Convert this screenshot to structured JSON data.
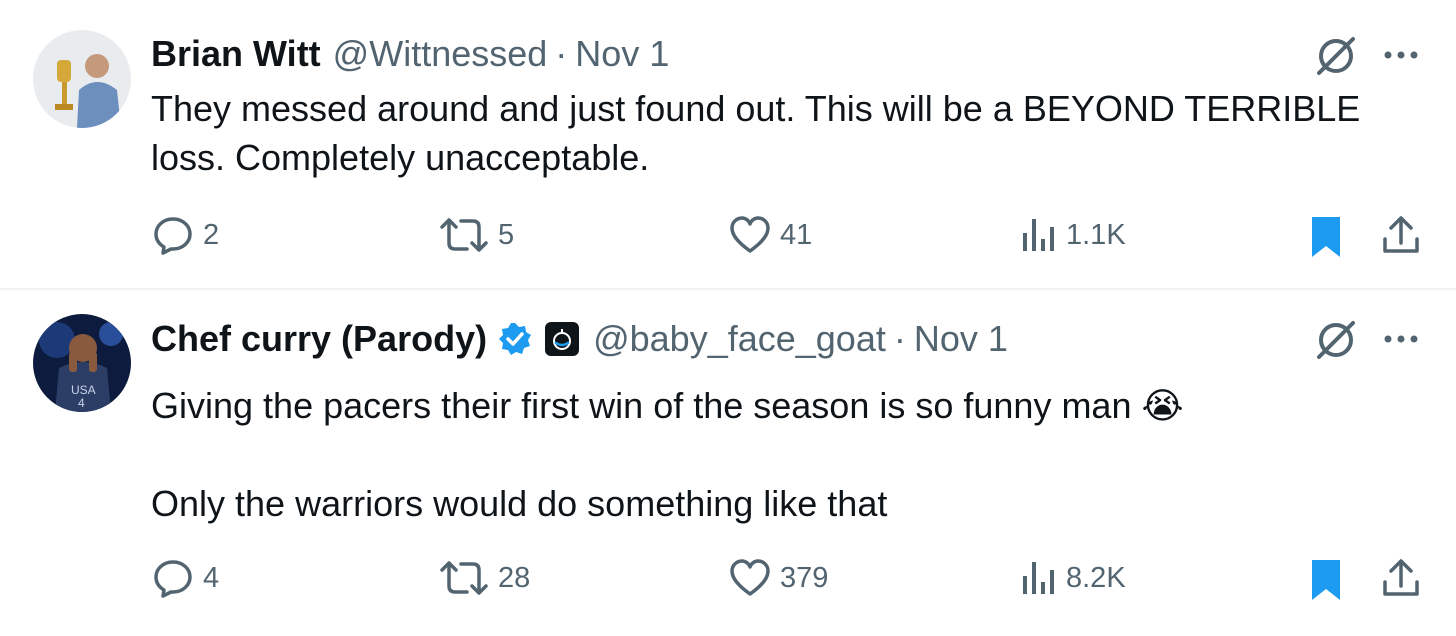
{
  "tweets": [
    {
      "name": "Brian Witt",
      "handle": "@Wittnessed",
      "dot": "·",
      "date": "Nov 1",
      "text": "They messed around and just found out. This will be a BEYOND TERRIBLE loss. Completely unacceptable.",
      "replies": "2",
      "reposts": "5",
      "likes": "41",
      "views": "1.1K",
      "bookmarked": true
    },
    {
      "name": "Chef curry (Parody)",
      "handle": "@baby_face_goat",
      "dot": "·",
      "date": "Nov 1",
      "verified": true,
      "text": "Giving the pacers their first win of the season is so funny man 😭\n\nOnly the warriors would do something like that",
      "replies": "4",
      "reposts": "28",
      "likes": "379",
      "views": "8.2K",
      "bookmarked": true
    }
  ],
  "colors": {
    "text": "#0f1419",
    "secondary": "#536471",
    "accent": "#1d9bf0",
    "divider": "#eff3f4"
  },
  "icons": [
    "reply-icon",
    "repost-icon",
    "like-icon",
    "views-icon",
    "bookmark-icon",
    "share-icon",
    "grok-icon",
    "more-icon",
    "verified-badge-icon"
  ]
}
